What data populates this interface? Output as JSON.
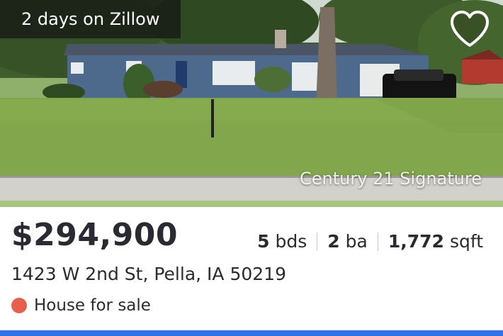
{
  "badge": {
    "days_on_market": "2 days on Zillow"
  },
  "photo": {
    "watermark": "Century 21 Signature"
  },
  "listing": {
    "price": "$294,900",
    "beds_value": "5",
    "beds_unit": "bds",
    "baths_value": "2",
    "baths_unit": "ba",
    "sqft_value": "1,772",
    "sqft_unit": "sqft",
    "address": "1423 W 2nd St, Pella, IA 50219",
    "status": "House for sale"
  },
  "colors": {
    "status_dot": "#e8604c",
    "accent_bar": "#2f6fea"
  },
  "icons": {
    "favorite": "heart-outline-icon"
  }
}
